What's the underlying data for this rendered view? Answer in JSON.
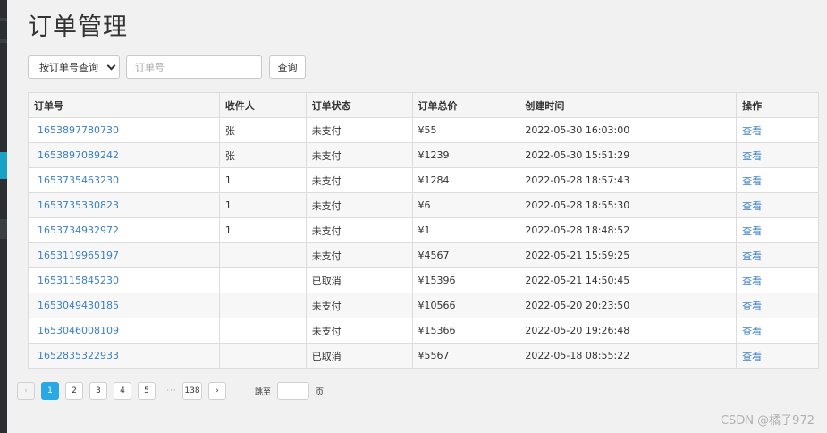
{
  "page": {
    "title": "订单管理"
  },
  "search": {
    "mode_selected": "按订单号查询",
    "placeholder": "订单号",
    "button_label": "查询"
  },
  "table": {
    "headers": [
      "订单号",
      "收件人",
      "订单状态",
      "订单总价",
      "创建时间",
      "操作"
    ],
    "rows": [
      {
        "order_id": "1653897780730",
        "recipient": "张",
        "status": "未支付",
        "total": "¥55",
        "created": "2022-05-30 16:03:00",
        "action": "查看"
      },
      {
        "order_id": "1653897089242",
        "recipient": "张",
        "status": "未支付",
        "total": "¥1239",
        "created": "2022-05-30 15:51:29",
        "action": "查看"
      },
      {
        "order_id": "1653735463230",
        "recipient": "1",
        "status": "未支付",
        "total": "¥1284",
        "created": "2022-05-28 18:57:43",
        "action": "查看"
      },
      {
        "order_id": "1653735330823",
        "recipient": "1",
        "status": "未支付",
        "total": "¥6",
        "created": "2022-05-28 18:55:30",
        "action": "查看"
      },
      {
        "order_id": "1653734932972",
        "recipient": "1",
        "status": "未支付",
        "total": "¥1",
        "created": "2022-05-28 18:48:52",
        "action": "查看"
      },
      {
        "order_id": "1653119965197",
        "recipient": "",
        "status": "未支付",
        "total": "¥4567",
        "created": "2022-05-21 15:59:25",
        "action": "查看"
      },
      {
        "order_id": "1653115845230",
        "recipient": "",
        "status": "已取消",
        "total": "¥15396",
        "created": "2022-05-21 14:50:45",
        "action": "查看"
      },
      {
        "order_id": "1653049430185",
        "recipient": "",
        "status": "未支付",
        "total": "¥10566",
        "created": "2022-05-20 20:23:50",
        "action": "查看"
      },
      {
        "order_id": "1653046008109",
        "recipient": "",
        "status": "未支付",
        "total": "¥15366",
        "created": "2022-05-20 19:26:48",
        "action": "查看"
      },
      {
        "order_id": "1652835322933",
        "recipient": "",
        "status": "已取消",
        "total": "¥5567",
        "created": "2022-05-18 08:55:22",
        "action": "查看"
      }
    ]
  },
  "pagination": {
    "prev": "‹",
    "pages": [
      "1",
      "2",
      "3",
      "4",
      "5"
    ],
    "current": "1",
    "ellipsis": "···",
    "last": "138",
    "next": "›",
    "jump_label": "跳至",
    "jump_unit": "页"
  },
  "watermark": "CSDN @橘子972",
  "colors": {
    "accent": "#2aa8e6",
    "link": "#3b7fc4",
    "sidebar_active": "#1ba1c7"
  }
}
